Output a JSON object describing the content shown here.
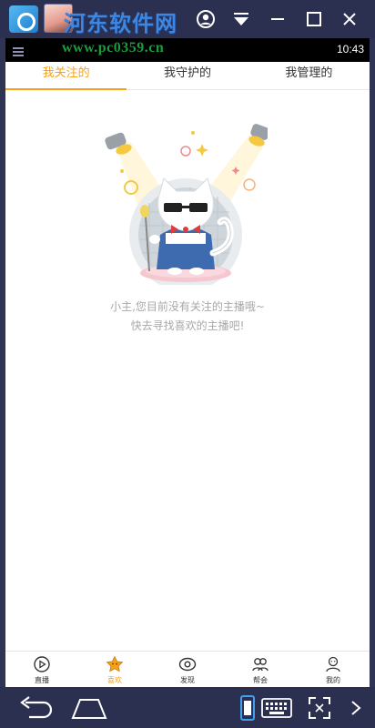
{
  "emulator": {
    "watermark_title": "河东软件网",
    "watermark_url": "www.pc0359.cn",
    "status_time": "10:43"
  },
  "tabs": [
    {
      "label": "我关注的",
      "active": true
    },
    {
      "label": "我守护的",
      "active": false
    },
    {
      "label": "我管理的",
      "active": false
    }
  ],
  "empty_state": {
    "line1": "小主,您目前没有关注的主播哦~",
    "line2": "快去寻找喜欢的主播吧!",
    "illustration": "cat-with-sunglasses-singing-icon"
  },
  "bottom_nav": [
    {
      "label": "直播",
      "icon": "play-circle-icon",
      "active": false
    },
    {
      "label": "喜欢",
      "icon": "star-icon",
      "active": true
    },
    {
      "label": "发现",
      "icon": "eye-icon",
      "active": false
    },
    {
      "label": "帮会",
      "icon": "group-icon",
      "active": false
    },
    {
      "label": "我的",
      "icon": "profile-icon",
      "active": false
    }
  ],
  "colors": {
    "accent": "#f5a11a",
    "frame": "#2c3050",
    "empty_text": "#a8a8a8"
  }
}
